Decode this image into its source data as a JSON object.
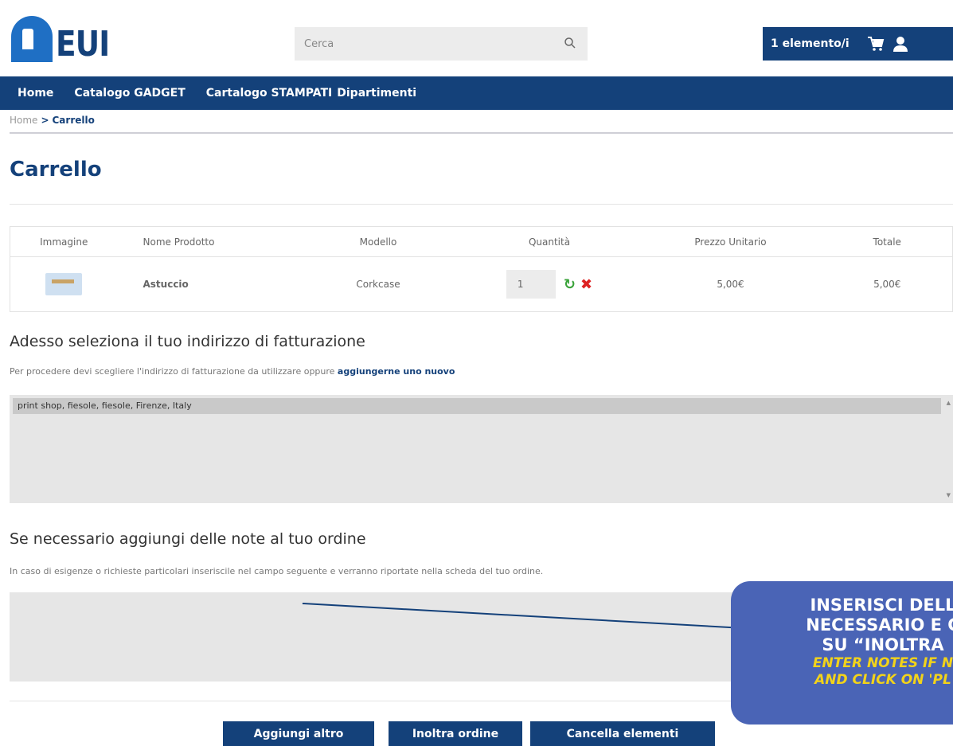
{
  "header": {
    "logo_text": "EUI",
    "search_placeholder": "Cerca",
    "cart_count_label": "1 elemento/i"
  },
  "nav": {
    "items": [
      "Home",
      "Catalogo GADGET",
      "Cartalogo STAMPATI",
      "Dipartimenti"
    ]
  },
  "breadcrumb": {
    "home": "Home",
    "separator": ">",
    "current": "Carrello"
  },
  "page": {
    "title": "Carrello"
  },
  "table": {
    "headers": [
      "Immagine",
      "Nome Prodotto",
      "Modello",
      "Quantità",
      "Prezzo Unitario",
      "Totale"
    ],
    "rows": [
      {
        "name": "Astuccio",
        "model": "Corkcase",
        "quantity": "1",
        "unit_price": "5,00€",
        "total": "5,00€"
      }
    ]
  },
  "billing": {
    "title": "Adesso seleziona il tuo indirizzo di fatturazione",
    "desc_prefix": "Per procedere devi scegliere l'indirizzo di fatturazione da utilizzare oppure ",
    "desc_link": "aggiungerne uno nuovo",
    "selected_address": "print shop, fiesole, fiesole, Firenze, Italy"
  },
  "notes": {
    "title": "Se necessario aggiungi delle note al tuo ordine",
    "desc": "In caso di esigenze o richieste particolari inseriscile nel campo seguente e verranno riportate nella scheda del tuo ordine."
  },
  "buttons": {
    "add_more": "Aggiungi altro",
    "forward_order": "Inoltra ordine",
    "clear_items": "Cancella elementi"
  },
  "callout": {
    "it_text": "INSERISCI DELL\nNECESSARIO E C\nSU “INOLTRA",
    "en_text": "ENTER NOTES IF N\nAND CLICK ON 'PL"
  },
  "colors": {
    "brand_navy": "#14417a",
    "logo_blue": "#1f6fc4",
    "price_red": "#c0392b",
    "callout_bg": "#4a64b6",
    "callout_yellow": "#f2d31a"
  }
}
